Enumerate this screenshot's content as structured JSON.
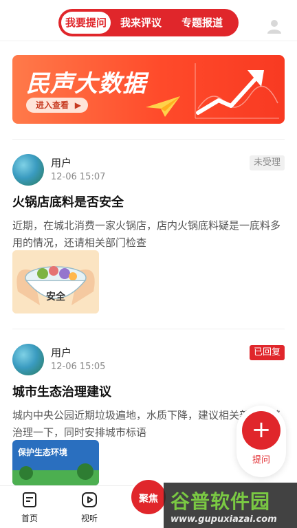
{
  "header": {
    "tabs": [
      {
        "label": "我要提问",
        "active": true
      },
      {
        "label": "我来评议",
        "active": false
      },
      {
        "label": "专题报道",
        "active": false
      }
    ],
    "avatar_icon": "user-icon"
  },
  "banner": {
    "title": "民声大数据",
    "enter_label": "进入查看",
    "enter_arrow": "▶",
    "colors": {
      "start": "#ff7a4a",
      "end": "#f83a22"
    }
  },
  "posts": [
    {
      "user": "用户",
      "time": "12-06 15:07",
      "status": "未受理",
      "status_color": "gray",
      "title": "火锅店底料是否安全",
      "body": "近期，在城北消费一家火锅店，店内火锅底料疑是一底料多用的情况，还请相关部门检查",
      "image_label": "安全"
    },
    {
      "user": "用户",
      "time": "12-06 15:05",
      "status": "已回复",
      "status_color": "red",
      "title": "城市生态治理建议",
      "body": "城内中央公园近期垃圾遍地，水质下降，建议相关部门能够治理一下，同时安排城市标语",
      "image_label": "保护生态环境"
    }
  ],
  "fab": {
    "icon": "plus-icon",
    "label": "提问"
  },
  "bottom_nav": {
    "items": [
      {
        "label": "首页",
        "icon": "home-doc-icon"
      },
      {
        "label": "视听",
        "icon": "play-icon"
      }
    ],
    "focus_label": "聚焦"
  },
  "watermark": {
    "main": "谷普软件园",
    "url": "www.gupuxiazai.com"
  },
  "accent_color": "#e0262b"
}
